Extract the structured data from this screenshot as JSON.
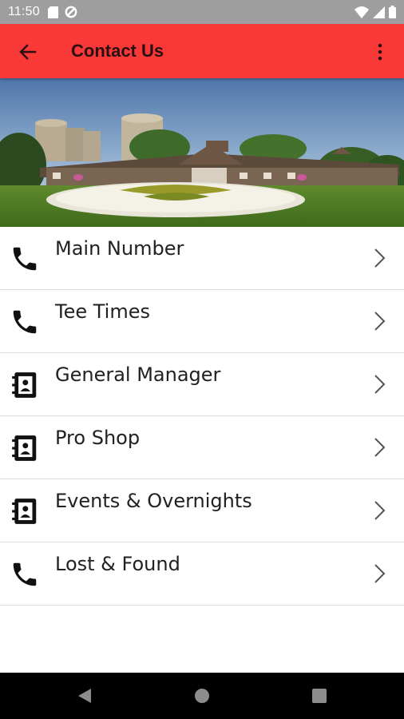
{
  "status_bar": {
    "time": "11:50",
    "left_icons": [
      "sd-card-icon",
      "data-saver-icon"
    ],
    "right_icons": [
      "wifi-icon",
      "signal-icon",
      "battery-icon"
    ]
  },
  "app_bar": {
    "title": "Contact Us",
    "back_icon": "arrow-back-icon",
    "menu_icon": "more-vert-icon",
    "background_color": "#f93838"
  },
  "hero": {
    "icon": "clubhouse-photo"
  },
  "contacts": [
    {
      "label": "Main Number",
      "icon": "phone-icon"
    },
    {
      "label": "Tee Times",
      "icon": "phone-icon"
    },
    {
      "label": "General Manager",
      "icon": "contact-book-icon"
    },
    {
      "label": "Pro Shop",
      "icon": "contact-book-icon"
    },
    {
      "label": "Events & Overnights",
      "icon": "contact-book-icon"
    },
    {
      "label": "Lost & Found",
      "icon": "phone-icon"
    }
  ],
  "nav_bar": {
    "buttons": [
      "back-triangle-icon",
      "home-circle-icon",
      "recents-square-icon"
    ]
  }
}
